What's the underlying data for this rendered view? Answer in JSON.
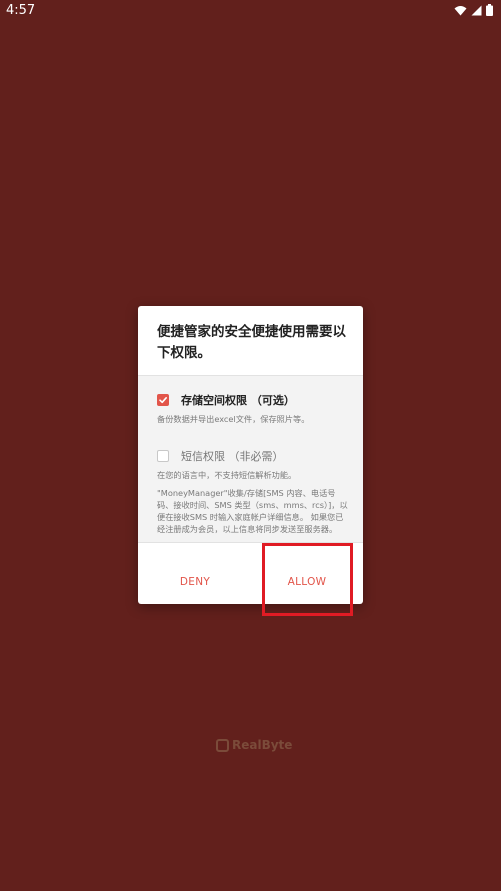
{
  "status_bar": {
    "time": "4:57",
    "icons": [
      "wifi-icon",
      "signal-icon",
      "battery-icon"
    ]
  },
  "dialog": {
    "title": "便捷管家的安全便捷使用需要以下权限。",
    "permissions": [
      {
        "label": "存储空间权限 （可选）",
        "checked": true,
        "description": "备份数据并导出excel文件，保存照片等。"
      },
      {
        "label": "短信权限 （非必需）",
        "checked": false,
        "description": "在您的语言中，不支持短信解析功能。",
        "detail": "\"MoneyManager\"收集/存储[SMS 内容、电话号码、接收时间、SMS 类型（sms、mms、rcs）]，以便在接收SMS 时输入家庭帐户详细信息。 如果您已经注册成为会员，以上信息将同步发送至服务器。"
      }
    ],
    "buttons": {
      "deny": "DENY",
      "allow": "ALLOW"
    }
  },
  "brand": {
    "name": "RealByte"
  },
  "colors": {
    "background": "#62201c",
    "accent": "#e2554a",
    "highlight": "#e01b24"
  }
}
